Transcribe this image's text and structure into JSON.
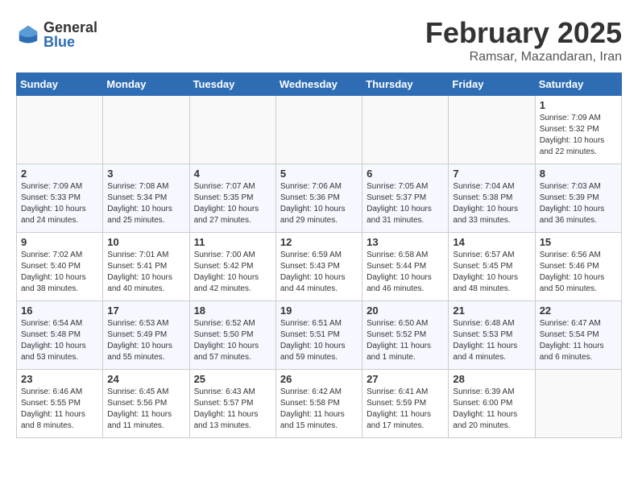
{
  "logo": {
    "general": "General",
    "blue": "Blue"
  },
  "title": "February 2025",
  "location": "Ramsar, Mazandaran, Iran",
  "days_of_week": [
    "Sunday",
    "Monday",
    "Tuesday",
    "Wednesday",
    "Thursday",
    "Friday",
    "Saturday"
  ],
  "weeks": [
    [
      {
        "day": "",
        "info": ""
      },
      {
        "day": "",
        "info": ""
      },
      {
        "day": "",
        "info": ""
      },
      {
        "day": "",
        "info": ""
      },
      {
        "day": "",
        "info": ""
      },
      {
        "day": "",
        "info": ""
      },
      {
        "day": "1",
        "info": "Sunrise: 7:09 AM\nSunset: 5:32 PM\nDaylight: 10 hours\nand 22 minutes."
      }
    ],
    [
      {
        "day": "2",
        "info": "Sunrise: 7:09 AM\nSunset: 5:33 PM\nDaylight: 10 hours\nand 24 minutes."
      },
      {
        "day": "3",
        "info": "Sunrise: 7:08 AM\nSunset: 5:34 PM\nDaylight: 10 hours\nand 25 minutes."
      },
      {
        "day": "4",
        "info": "Sunrise: 7:07 AM\nSunset: 5:35 PM\nDaylight: 10 hours\nand 27 minutes."
      },
      {
        "day": "5",
        "info": "Sunrise: 7:06 AM\nSunset: 5:36 PM\nDaylight: 10 hours\nand 29 minutes."
      },
      {
        "day": "6",
        "info": "Sunrise: 7:05 AM\nSunset: 5:37 PM\nDaylight: 10 hours\nand 31 minutes."
      },
      {
        "day": "7",
        "info": "Sunrise: 7:04 AM\nSunset: 5:38 PM\nDaylight: 10 hours\nand 33 minutes."
      },
      {
        "day": "8",
        "info": "Sunrise: 7:03 AM\nSunset: 5:39 PM\nDaylight: 10 hours\nand 36 minutes."
      }
    ],
    [
      {
        "day": "9",
        "info": "Sunrise: 7:02 AM\nSunset: 5:40 PM\nDaylight: 10 hours\nand 38 minutes."
      },
      {
        "day": "10",
        "info": "Sunrise: 7:01 AM\nSunset: 5:41 PM\nDaylight: 10 hours\nand 40 minutes."
      },
      {
        "day": "11",
        "info": "Sunrise: 7:00 AM\nSunset: 5:42 PM\nDaylight: 10 hours\nand 42 minutes."
      },
      {
        "day": "12",
        "info": "Sunrise: 6:59 AM\nSunset: 5:43 PM\nDaylight: 10 hours\nand 44 minutes."
      },
      {
        "day": "13",
        "info": "Sunrise: 6:58 AM\nSunset: 5:44 PM\nDaylight: 10 hours\nand 46 minutes."
      },
      {
        "day": "14",
        "info": "Sunrise: 6:57 AM\nSunset: 5:45 PM\nDaylight: 10 hours\nand 48 minutes."
      },
      {
        "day": "15",
        "info": "Sunrise: 6:56 AM\nSunset: 5:46 PM\nDaylight: 10 hours\nand 50 minutes."
      }
    ],
    [
      {
        "day": "16",
        "info": "Sunrise: 6:54 AM\nSunset: 5:48 PM\nDaylight: 10 hours\nand 53 minutes."
      },
      {
        "day": "17",
        "info": "Sunrise: 6:53 AM\nSunset: 5:49 PM\nDaylight: 10 hours\nand 55 minutes."
      },
      {
        "day": "18",
        "info": "Sunrise: 6:52 AM\nSunset: 5:50 PM\nDaylight: 10 hours\nand 57 minutes."
      },
      {
        "day": "19",
        "info": "Sunrise: 6:51 AM\nSunset: 5:51 PM\nDaylight: 10 hours\nand 59 minutes."
      },
      {
        "day": "20",
        "info": "Sunrise: 6:50 AM\nSunset: 5:52 PM\nDaylight: 11 hours\nand 1 minute."
      },
      {
        "day": "21",
        "info": "Sunrise: 6:48 AM\nSunset: 5:53 PM\nDaylight: 11 hours\nand 4 minutes."
      },
      {
        "day": "22",
        "info": "Sunrise: 6:47 AM\nSunset: 5:54 PM\nDaylight: 11 hours\nand 6 minutes."
      }
    ],
    [
      {
        "day": "23",
        "info": "Sunrise: 6:46 AM\nSunset: 5:55 PM\nDaylight: 11 hours\nand 8 minutes."
      },
      {
        "day": "24",
        "info": "Sunrise: 6:45 AM\nSunset: 5:56 PM\nDaylight: 11 hours\nand 11 minutes."
      },
      {
        "day": "25",
        "info": "Sunrise: 6:43 AM\nSunset: 5:57 PM\nDaylight: 11 hours\nand 13 minutes."
      },
      {
        "day": "26",
        "info": "Sunrise: 6:42 AM\nSunset: 5:58 PM\nDaylight: 11 hours\nand 15 minutes."
      },
      {
        "day": "27",
        "info": "Sunrise: 6:41 AM\nSunset: 5:59 PM\nDaylight: 11 hours\nand 17 minutes."
      },
      {
        "day": "28",
        "info": "Sunrise: 6:39 AM\nSunset: 6:00 PM\nDaylight: 11 hours\nand 20 minutes."
      },
      {
        "day": "",
        "info": ""
      }
    ]
  ]
}
